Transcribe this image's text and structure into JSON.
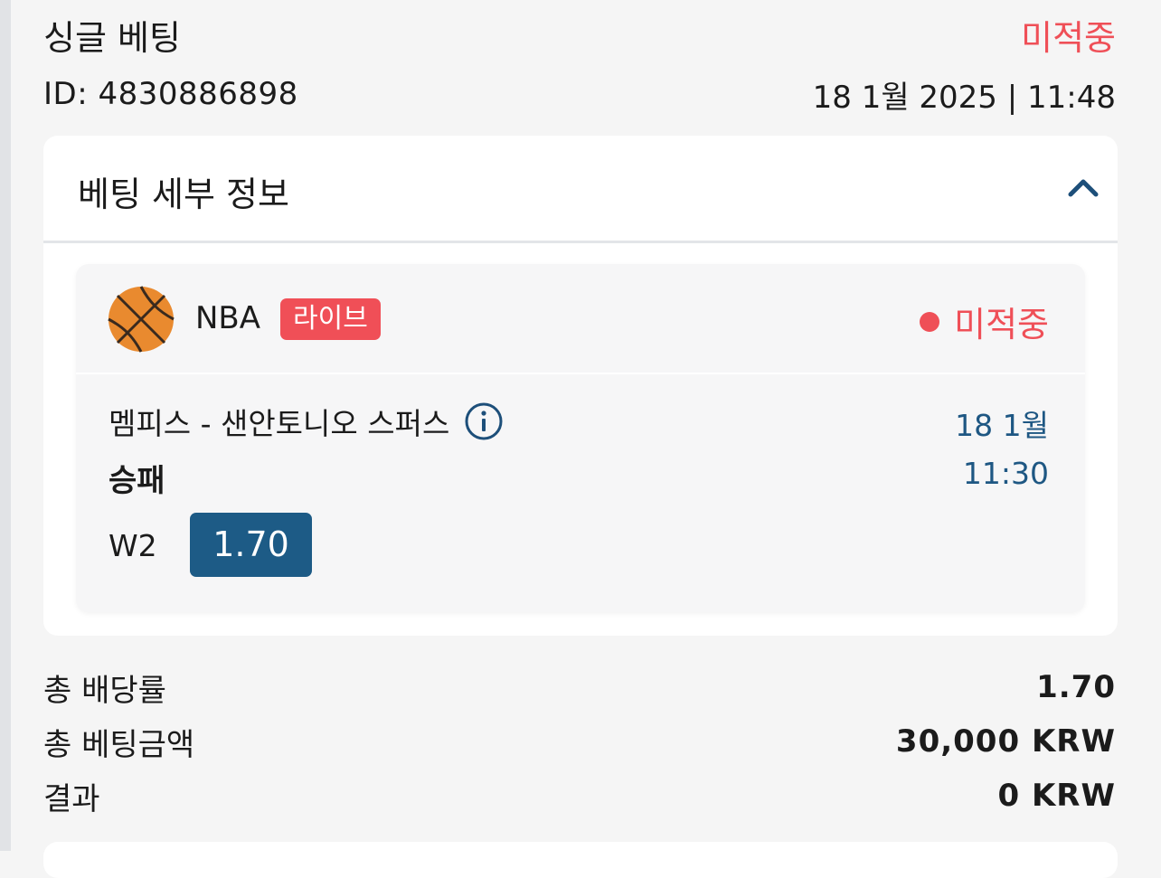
{
  "bet": {
    "type_label": "싱글 베팅",
    "status": "미적중",
    "id_text": "ID: 4830886898",
    "datetime": "18 1월 2025 | 11:48"
  },
  "details": {
    "title": "베팅 세부 정보",
    "collapse_icon": "chevron-up-icon"
  },
  "event": {
    "sport_icon": "basketball-icon",
    "league": "NBA",
    "live_badge": "라이브",
    "status": "미적중",
    "match": "멤피스 - 샌안토니오 스퍼스",
    "info_icon": "info-icon",
    "date": "18 1월",
    "market": "승패",
    "time": "11:30",
    "outcome": "W2",
    "odds": "1.70"
  },
  "summary": {
    "total_odds_label": "총 배당률",
    "total_odds_value": "1.70",
    "total_stake_label": "총 베팅금액",
    "total_stake_value": "30,000 KRW",
    "result_label": "결과",
    "result_value": "0 KRW"
  },
  "colors": {
    "status_red": "#ef4f57",
    "odds_blue": "#1d5b86",
    "time_blue": "#1e5783",
    "basketball_orange": "#e98a2f"
  }
}
